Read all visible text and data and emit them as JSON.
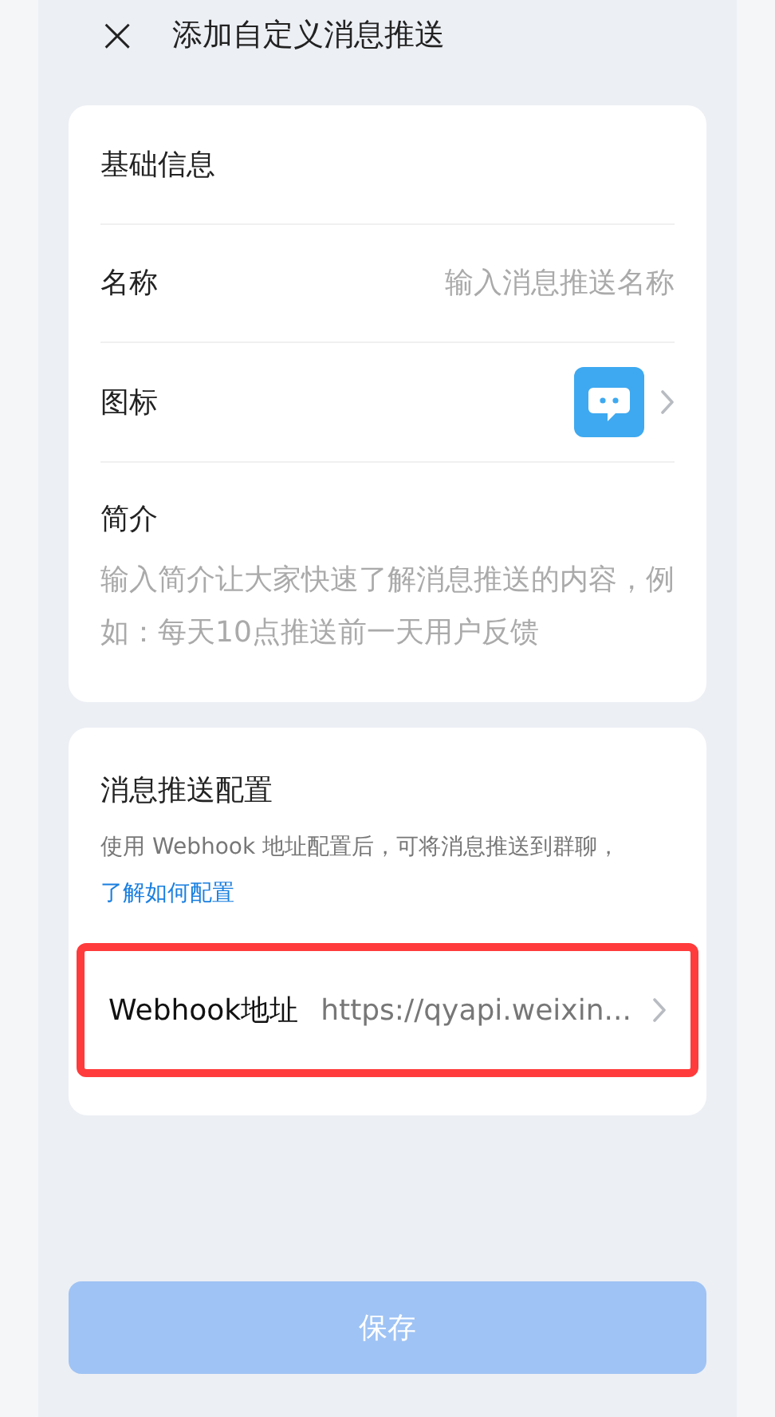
{
  "header": {
    "close": "×",
    "title": "添加自定义消息推送"
  },
  "basic_info": {
    "title": "基础信息",
    "name": {
      "label": "名称",
      "placeholder": "输入消息推送名称"
    },
    "icon": {
      "label": "图标"
    },
    "intro": {
      "label": "简介",
      "placeholder": "输入简介让大家快速了解消息推送的内容，例如：每天10点推送前一天用户反馈"
    }
  },
  "push_config": {
    "title": "消息推送配置",
    "description": "使用 Webhook 地址配置后，可将消息推送到群聊，",
    "link": "了解如何配置",
    "webhook": {
      "label": "Webhook地址",
      "value": "https://qyapi.weixin...",
      "highlighted": true
    }
  },
  "save_button": {
    "label": "保存",
    "disabled": true
  }
}
